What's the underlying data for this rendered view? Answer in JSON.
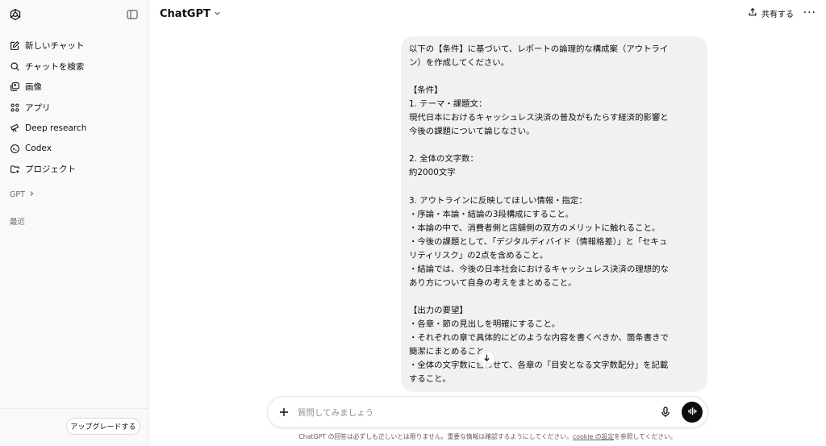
{
  "sidebar": {
    "items": [
      {
        "icon": "new-chat-icon",
        "label": "新しいチャット"
      },
      {
        "icon": "search-icon",
        "label": "チャットを検索"
      },
      {
        "icon": "image-icon",
        "label": "画像"
      },
      {
        "icon": "apps-icon",
        "label": "アプリ"
      },
      {
        "icon": "telescope-icon",
        "label": "Deep research"
      },
      {
        "icon": "codex-icon",
        "label": "Codex"
      },
      {
        "icon": "folder-plus-icon",
        "label": "プロジェクト"
      }
    ],
    "gpt_section": "GPT",
    "recent_section": "最近",
    "upgrade_label": "アップグレードする"
  },
  "header": {
    "model_title": "ChatGPT",
    "share_label": "共有する",
    "more_label": "···"
  },
  "message": {
    "lines": [
      "以下の【条件】に基づいて、レポートの論理的な構成案（アウトライ",
      "ン）を作成してください。",
      "",
      "【条件】",
      "1. テーマ・課題文：",
      "現代日本におけるキャッシュレス決済の普及がもたらす経済的影響と",
      "今後の課題について論じなさい。",
      "",
      "2. 全体の文字数：",
      "約2000文字",
      "",
      "3. アウトラインに反映してほしい情報・指定：",
      "・序論・本論・結論の3段構成にすること。",
      "・本論の中で、消費者側と店舗側の双方のメリットに触れること。",
      "・今後の課題として、「デジタルディバイド（情報格差）」と「セキュ",
      "リティリスク」の2点を含めること。",
      "・結論では、今後の日本社会におけるキャッシュレス決済の理想的な",
      "あり方について自身の考えをまとめること。",
      "",
      "【出力の要望】",
      "・各章・節の見出しを明確にすること。",
      "・それぞれの章で具体的にどのような内容を書くべきか、箇条書きで",
      "簡潔にまとめること。",
      "・全体の文字数に合わせて、各章の「目安となる文字数配分」を記載",
      "すること。"
    ]
  },
  "composer": {
    "placeholder": "質問してみましょう"
  },
  "footer": {
    "disclaimer_pre": "ChatGPT の回答は必ずしも正しいとは限りません。重要な情報は確認するようにしてください。",
    "disclaimer_link": "cookie の設定",
    "disclaimer_post": "を参照してください。"
  }
}
